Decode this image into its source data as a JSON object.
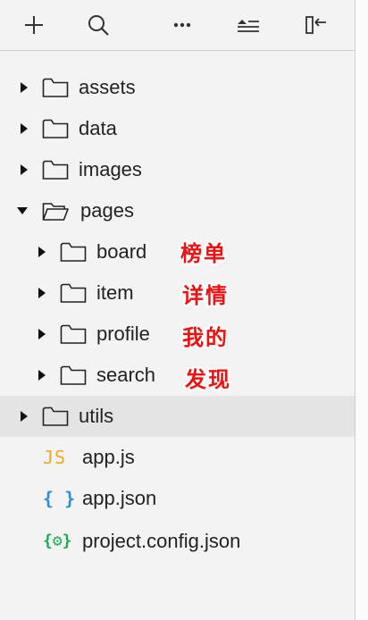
{
  "toolbar": {
    "buttons": [
      {
        "name": "add-file",
        "icon": "plus-icon"
      },
      {
        "name": "search",
        "icon": "search-icon"
      },
      {
        "name": "more",
        "icon": "more-icon"
      },
      {
        "name": "collapse-all",
        "icon": "collapse-icon"
      },
      {
        "name": "hide-sidebar",
        "icon": "sidebar-collapse-icon"
      }
    ]
  },
  "tree": {
    "assets": "assets",
    "data": "data",
    "images": "images",
    "pages": "pages",
    "board": "board",
    "item": "item",
    "profile": "profile",
    "search": "search",
    "utils": "utils",
    "app_js": "app.js",
    "app_json": "app.json",
    "project_config": "project.config.json"
  },
  "file_icons": {
    "js": "JS",
    "json": "{ }",
    "config": "{⚙}"
  },
  "annotations": {
    "board": "榜单",
    "item": "详情",
    "profile": "我的",
    "search": "发现"
  },
  "colors": {
    "annotation": "#ee1111",
    "js_icon": "#f5a623",
    "json_icon": "#2d8fd6",
    "config_icon": "#1aaa55",
    "selected_row": "#e4e4e4"
  },
  "selected": "utils"
}
